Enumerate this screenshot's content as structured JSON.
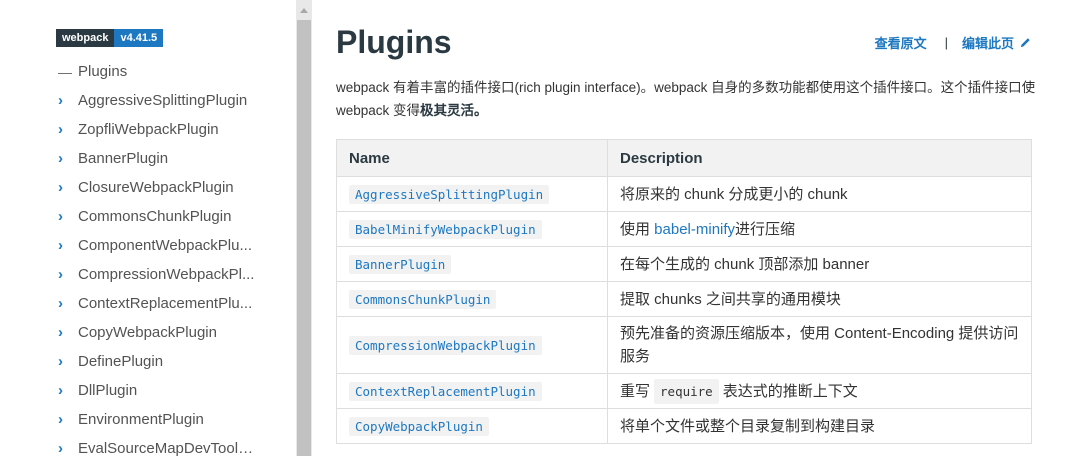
{
  "sidebar": {
    "badge_name": "webpack",
    "badge_version": "v4.41.5",
    "items": [
      {
        "label": "Plugins",
        "marker": "—"
      },
      {
        "label": "AggressiveSplittingPlugin",
        "marker": "›"
      },
      {
        "label": "ZopfliWebpackPlugin",
        "marker": "›"
      },
      {
        "label": "BannerPlugin",
        "marker": "›"
      },
      {
        "label": "ClosureWebpackPlugin",
        "marker": "›"
      },
      {
        "label": "CommonsChunkPlugin",
        "marker": "›"
      },
      {
        "label": "ComponentWebpackPlu...",
        "marker": "›"
      },
      {
        "label": "CompressionWebpackPl...",
        "marker": "›"
      },
      {
        "label": "ContextReplacementPlu...",
        "marker": "›"
      },
      {
        "label": "CopyWebpackPlugin",
        "marker": "›"
      },
      {
        "label": "DefinePlugin",
        "marker": "›"
      },
      {
        "label": "DllPlugin",
        "marker": "›"
      },
      {
        "label": "EnvironmentPlugin",
        "marker": "›"
      },
      {
        "label": "EvalSourceMapDevToolP...",
        "marker": "›"
      }
    ]
  },
  "main": {
    "title": "Plugins",
    "view_source": "查看原文",
    "divider": "|",
    "edit_page": "编辑此页",
    "intro_text": "webpack 有着丰富的插件接口(rich plugin interface)。webpack 自身的多数功能都使用这个插件接口。这个插件接口使 webpack 变得",
    "intro_strong": "极其灵活。",
    "table": {
      "headers": [
        "Name",
        "Description"
      ],
      "rows": [
        {
          "name": "AggressiveSplittingPlugin",
          "desc": "将原来的 chunk 分成更小的 chunk"
        },
        {
          "name": "BabelMinifyWebpackPlugin",
          "desc_pre": "使用 ",
          "desc_link": "babel-minify",
          "desc_post": "进行压缩"
        },
        {
          "name": "BannerPlugin",
          "desc": "在每个生成的 chunk 顶部添加 banner"
        },
        {
          "name": "CommonsChunkPlugin",
          "desc": "提取 chunks 之间共享的通用模块"
        },
        {
          "name": "CompressionWebpackPlugin",
          "desc": "预先准备的资源压缩版本，使用 Content-Encoding 提供访问服务"
        },
        {
          "name": "ContextReplacementPlugin",
          "desc_pre": "重写",
          "desc_code": "require",
          "desc_post": "表达式的推断上下文"
        },
        {
          "name": "CopyWebpackPlugin",
          "desc": "将单个文件或整个目录复制到构建目录"
        }
      ]
    }
  },
  "colors": {
    "accent": "#1d78c1",
    "dark": "#2b3a42",
    "header_bg": "#f2f2f2"
  },
  "icons": {
    "edit": "pencil-icon",
    "expand": "chevron-right-icon",
    "collapse": "dash-icon"
  }
}
